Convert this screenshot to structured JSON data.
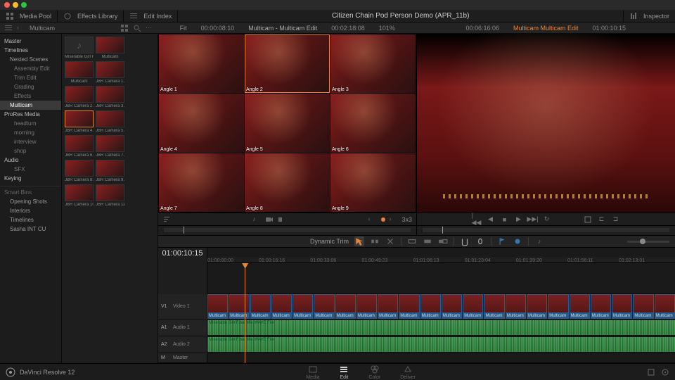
{
  "app": {
    "title": "Citizen Chain Pod Person Demo (APR_11b)",
    "name": "DaVinci Resolve 12"
  },
  "topbar": {
    "media_pool": "Media Pool",
    "effects_library": "Effects Library",
    "edit_index": "Edit Index",
    "inspector": "Inspector"
  },
  "breadcrumb": {
    "bin": "Multicam"
  },
  "source_viewer": {
    "fit": "Fit",
    "tc_left": "00:00:08:10",
    "name": "Multicam - Multicam Edit",
    "tc_right": "00:02:18:08",
    "zoom": "101%",
    "grid": "3x3"
  },
  "program_viewer": {
    "tc_left": "00:06:16:06",
    "name": "Multicam Multicam Edit",
    "tc_right": "01:00:10:15"
  },
  "sidebar": {
    "items": [
      {
        "label": "Master",
        "type": "hdr"
      },
      {
        "label": "Timelines",
        "type": "hdr"
      },
      {
        "label": "Nested Scenes",
        "type": "item"
      },
      {
        "label": "Assembly Edit",
        "type": "sub"
      },
      {
        "label": "Trim Edit",
        "type": "sub"
      },
      {
        "label": "Grading",
        "type": "sub"
      },
      {
        "label": "Effects",
        "type": "sub"
      },
      {
        "label": "Multicam",
        "type": "active"
      },
      {
        "label": "ProRes Media",
        "type": "hdr"
      },
      {
        "label": "headturn",
        "type": "sub"
      },
      {
        "label": "morning",
        "type": "sub"
      },
      {
        "label": "interview",
        "type": "sub"
      },
      {
        "label": "shop",
        "type": "sub"
      },
      {
        "label": "Audio",
        "type": "hdr"
      },
      {
        "label": "SFX",
        "type": "sub"
      },
      {
        "label": "Keying",
        "type": "hdr"
      }
    ],
    "smart_bins_label": "Smart Bins",
    "smart_bins": [
      "Opening Shots",
      "Interiors",
      "Timelines",
      "Sasha INT CU"
    ]
  },
  "clips": [
    {
      "name": "Miserable Girl Final ...",
      "audio": true
    },
    {
      "name": "Multicam"
    },
    {
      "name": "Multicam"
    },
    {
      "name": "JBR Camera 1.mov"
    },
    {
      "name": "JBR Camera 2.mov"
    },
    {
      "name": "JBR Camera 3.mov"
    },
    {
      "name": "JBR Camera 4.mov",
      "sel": true
    },
    {
      "name": "JBR Camera 5.mov"
    },
    {
      "name": "JBR Camera 6.mov"
    },
    {
      "name": "JBR Camera 7.mov"
    },
    {
      "name": "JBR Camera 8.mov"
    },
    {
      "name": "JBR Camera 9.mov"
    },
    {
      "name": "JBR Camera 10.mov"
    },
    {
      "name": "JBR Camera 11.mov"
    }
  ],
  "mc_angles": [
    "Angle 1",
    "Angle 2",
    "Angle 3",
    "Angle 4",
    "Angle 5",
    "Angle 6",
    "Angle 7",
    "Angle 8",
    "Angle 9"
  ],
  "toolbar": {
    "mode": "Dynamic Trim"
  },
  "timeline": {
    "tc": "01:00:10:15",
    "ticks": [
      "01:00:00:00",
      "01:00:16:16",
      "01:00:33:06",
      "01:00:49:23",
      "01:01:06:13",
      "01:01:23:04",
      "01:01:39:20",
      "01:01:56:11",
      "01:02:13:01"
    ],
    "tracks": {
      "v1": {
        "id": "V1",
        "name": "Video 1"
      },
      "a1": {
        "id": "A1",
        "name": "Audio 1"
      },
      "a2": {
        "id": "A2",
        "name": "Audio 2"
      },
      "m": {
        "id": "M",
        "name": "Master"
      }
    },
    "vclip_label": "Multicam",
    "aclip_label": "Miserable Girl Final Mix.WAVE File"
  },
  "pages": {
    "media": "Media",
    "edit": "Edit",
    "color": "Color",
    "deliver": "Deliver"
  }
}
